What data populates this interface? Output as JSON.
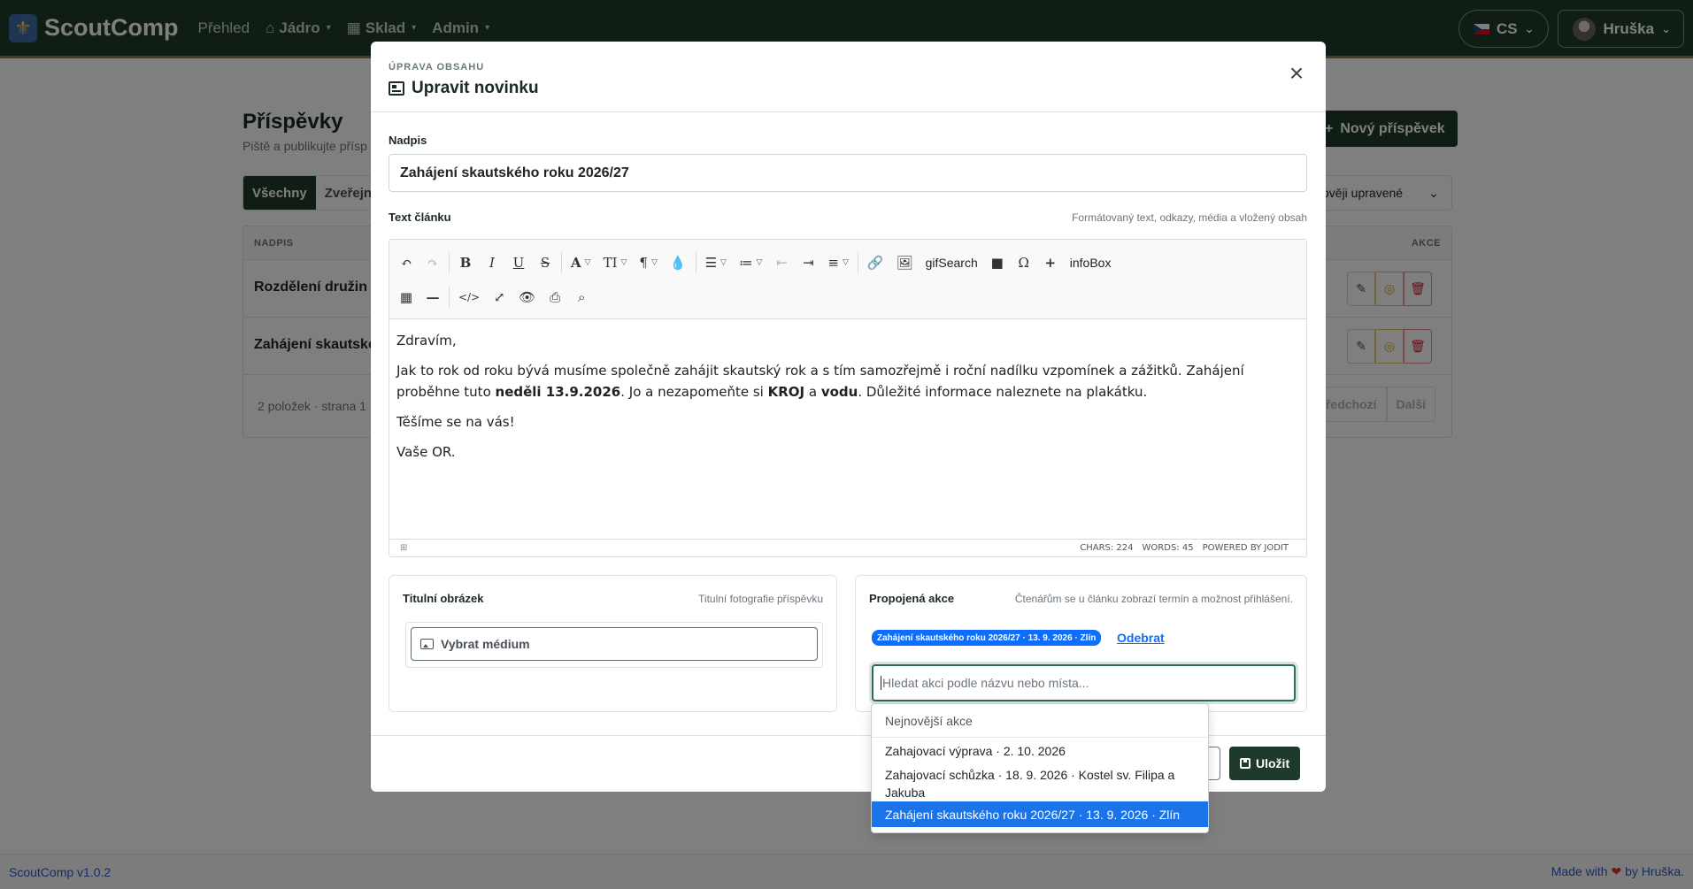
{
  "navbar": {
    "brand": "ScoutComp",
    "links": [
      {
        "label": "Přehled"
      },
      {
        "label": "Jádro"
      },
      {
        "label": "Sklad"
      },
      {
        "label": "Admin"
      }
    ],
    "language": "CS",
    "user": "Hruška"
  },
  "page": {
    "title": "Příspěvky",
    "subtitle": "Piště a publikujte přísp",
    "new_button": "Nový příspěvek",
    "filter_tabs": [
      "Všechny",
      "Zveřejně"
    ],
    "sort": "ověji upravené",
    "table": {
      "header_title": "NADPIS",
      "header_actions": "AKCE",
      "rows": [
        "Rozdělení družin v",
        "Zahájení skautské"
      ],
      "footer": "2 položek · strana 1",
      "prev": "Předchozí",
      "next": "Další"
    }
  },
  "footer": {
    "version": "ScoutComp v1.0.2",
    "made_prefix": "Made with",
    "made_suffix": "by Hruška."
  },
  "modal": {
    "kicker": "ÚPRAVA OBSAHU",
    "title": "Upravit novinku",
    "fields": {
      "title_label": "Nadpis",
      "title_value": "Zahájení skautského roku 2026/27",
      "text_label": "Text článku",
      "text_hint": "Formátovaný text, odkazy, média a vložený obsah"
    },
    "editor": {
      "toolbar_words": {
        "gif": "gifSearch",
        "info": "infoBox"
      },
      "content": {
        "greeting": "Zdravím,",
        "p1_a": "Jak to rok od roku bývá musíme společně zahájit skautský rok a s tím samozřejmě i roční nadílku vzpomínek a zážitků. Zahájení proběhne tuto ",
        "p1_b": "neděli 13.9.2026",
        "p1_c": ". Jo a nezapomeňte si ",
        "p1_d": "KROJ",
        "p1_e": " a ",
        "p1_f": "vodu",
        "p1_g": ". Důležité informace naleznete na plakátku.",
        "p2": "Těšíme se na vás!",
        "p3": "Vaše OR."
      },
      "status": {
        "chars": "CHARS: 224",
        "words": "WORDS: 45",
        "powered": "POWERED BY JODIT"
      }
    },
    "cover": {
      "label": "Titulní obrázek",
      "hint": "Titulní fotografie příspěvku",
      "button": "Vybrat médium"
    },
    "event": {
      "label": "Propojená akce",
      "hint": "Čtenářům se u článku zobrazí termín a možnost přihlášení.",
      "badge": "Zahájení skautského roku 2026/27 · 13. 9. 2026 · Zlín",
      "remove": "Odebrat",
      "search_placeholder": "Hledat akci podle názvu nebo místa..."
    },
    "save": "Uložit"
  },
  "dropdown": {
    "header": "Nejnovější akce",
    "items": [
      "Zahajovací výprava · 2. 10. 2026",
      "Zahajovací schůzka · 18. 9. 2026 · Kostel sv. Filipa a Jakuba",
      "Zahájení skautského roku 2026/27 · 13. 9. 2026 · Zlín"
    ]
  },
  "colors": {
    "brand": "#1e3a2b",
    "accent": "#0d6efd",
    "selection": "#1a73e8"
  }
}
